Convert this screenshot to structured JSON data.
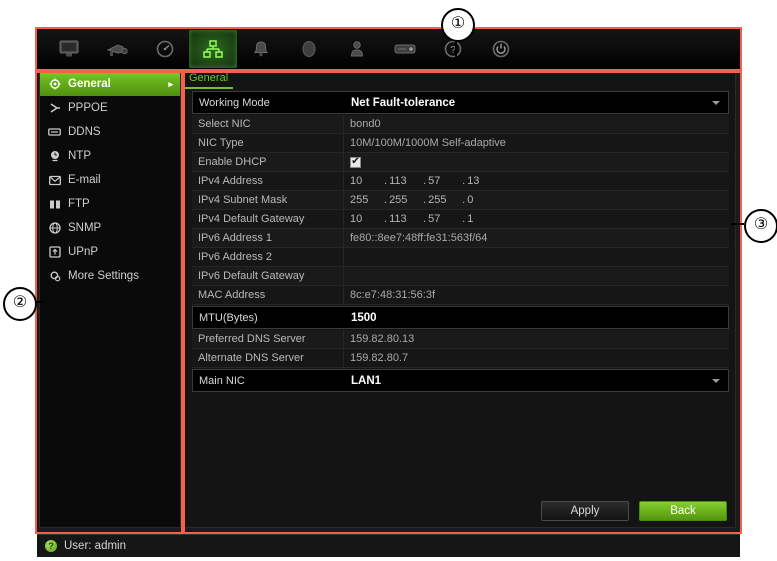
{
  "callouts": [
    {
      "id": "callout-1",
      "label": "①"
    },
    {
      "id": "callout-2",
      "label": "②"
    },
    {
      "id": "callout-3",
      "label": "③"
    }
  ],
  "toolbar": {
    "icons": [
      {
        "name": "monitor-icon",
        "label": "Display",
        "active": false
      },
      {
        "name": "camera-icon",
        "label": "Camera",
        "active": false
      },
      {
        "name": "record-icon",
        "label": "Record",
        "active": false
      },
      {
        "name": "network-icon",
        "label": "Network",
        "active": true
      },
      {
        "name": "alarm-bell-icon",
        "label": "Alarm",
        "active": false
      },
      {
        "name": "hdd-icon",
        "label": "HDD",
        "active": false
      },
      {
        "name": "user-icon",
        "label": "User",
        "active": false
      },
      {
        "name": "device-icon",
        "label": "Device",
        "active": false
      },
      {
        "name": "help-icon",
        "label": "Help",
        "active": false
      },
      {
        "name": "power-icon",
        "label": "Shutdown",
        "active": false
      }
    ]
  },
  "sidebar": {
    "items": [
      {
        "label": "General",
        "icon": "gear-icon",
        "selected": true
      },
      {
        "label": "PPPOE",
        "icon": "pppoe-icon",
        "selected": false
      },
      {
        "label": "DDNS",
        "icon": "ddns-icon",
        "selected": false
      },
      {
        "label": "NTP",
        "icon": "ntp-clock-icon",
        "selected": false
      },
      {
        "label": "E-mail",
        "icon": "envelope-icon",
        "selected": false
      },
      {
        "label": "FTP",
        "icon": "ftp-icon",
        "selected": false
      },
      {
        "label": "SNMP",
        "icon": "globe-icon",
        "selected": false
      },
      {
        "label": "UPnP",
        "icon": "upnp-icon",
        "selected": false
      },
      {
        "label": "More Settings",
        "icon": "settings-gear-icon",
        "selected": false
      }
    ],
    "selected_arrow": "▸"
  },
  "panel": {
    "tab_label": "General",
    "rows": [
      {
        "label": "Working Mode",
        "value": "Net Fault-tolerance",
        "type": "dropdown"
      },
      {
        "label": "Select NIC",
        "value": "bond0",
        "type": "text"
      },
      {
        "label": "NIC Type",
        "value": "10M/100M/1000M Self-adaptive",
        "type": "text"
      },
      {
        "label": "Enable DHCP",
        "value": "",
        "type": "checkbox",
        "checked": true
      },
      {
        "label": "IPv4 Address",
        "value": "10.113.57.13",
        "type": "ip",
        "octets": [
          "10",
          "113",
          "57",
          "13"
        ]
      },
      {
        "label": "IPv4 Subnet Mask",
        "value": "255.255.255.0",
        "type": "ip",
        "octets": [
          "255",
          "255",
          "255",
          "0"
        ]
      },
      {
        "label": "IPv4 Default Gateway",
        "value": "10.113.57.1",
        "type": "ip",
        "octets": [
          "10",
          "113",
          "57",
          "1"
        ]
      },
      {
        "label": "IPv6 Address 1",
        "value": "fe80::8ee7:48ff:fe31:563f/64",
        "type": "text"
      },
      {
        "label": "IPv6 Address 2",
        "value": "",
        "type": "text"
      },
      {
        "label": "IPv6 Default Gateway",
        "value": "",
        "type": "text"
      },
      {
        "label": "MAC Address",
        "value": "8c:e7:48:31:56:3f",
        "type": "text"
      },
      {
        "label": "MTU(Bytes)",
        "value": "1500",
        "type": "input"
      },
      {
        "label": "Preferred DNS Server",
        "value": "159.82.80.13",
        "type": "text"
      },
      {
        "label": "Alternate DNS Server",
        "value": "159.82.80.7",
        "type": "text"
      },
      {
        "label": "Main NIC",
        "value": "LAN1",
        "type": "dropdown"
      }
    ]
  },
  "footer": {
    "apply_label": "Apply",
    "back_label": "Back"
  },
  "statusbar": {
    "user_label": "User: admin"
  },
  "colors": {
    "accent_green": "#74c12e",
    "annotation_red": "#f4604c",
    "panel_background": "#141414"
  }
}
